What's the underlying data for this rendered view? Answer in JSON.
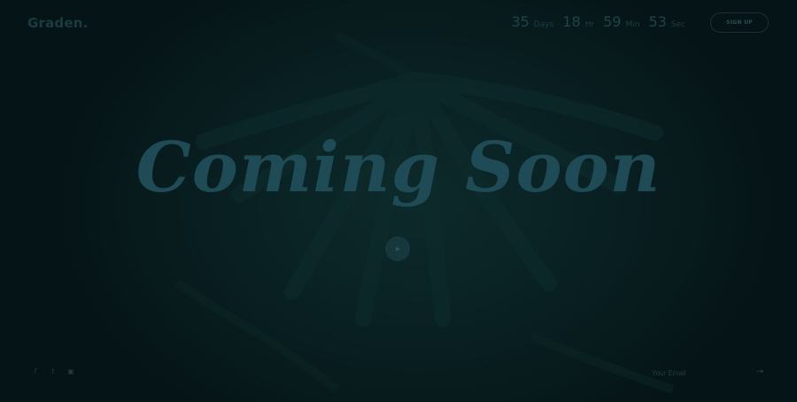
{
  "header": {
    "logo": "Graden.",
    "countdown": [
      {
        "value": "35",
        "label": "Days"
      },
      {
        "value": "18",
        "label": "Hr"
      },
      {
        "value": "59",
        "label": "Min"
      },
      {
        "value": "53",
        "label": "Sec"
      }
    ],
    "signup_label": "SIGN UP"
  },
  "hero": {
    "title": "Coming Soon",
    "play_icon": "play-icon",
    "title_color": "#1e4b55"
  },
  "footer": {
    "social": [
      {
        "icon": "facebook-icon",
        "glyph": "f"
      },
      {
        "icon": "twitter-icon",
        "glyph": "t"
      },
      {
        "icon": "youtube-icon",
        "glyph": "▣"
      }
    ],
    "email_placeholder": "Your Email",
    "submit_glyph": "→"
  },
  "colors": {
    "background": "#061619",
    "accent": "#1e4b55"
  }
}
